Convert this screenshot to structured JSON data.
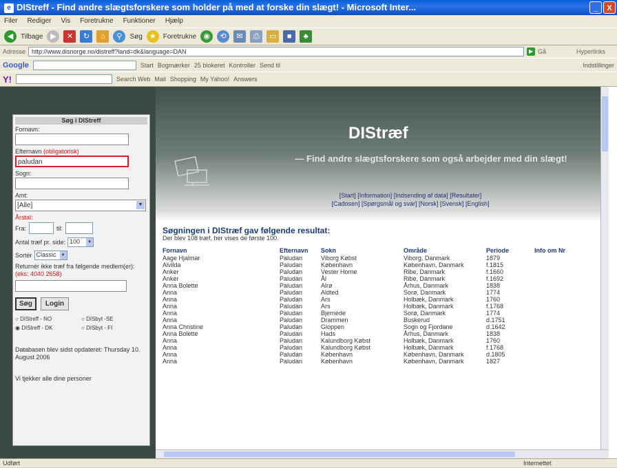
{
  "window": {
    "title": "DIStreff - Find andre slægtsforskere som holder på med at forske din slægt! - Microsoft Inter...",
    "minimize": "_",
    "close": "X"
  },
  "menubar": {
    "items": [
      "Filer",
      "Rediger",
      "Vis",
      "Foretrukne",
      "Funktioner",
      "Hjælp"
    ]
  },
  "toolbar": {
    "back": "Tilbage",
    "search": "Søg",
    "favorites": "Foretrukne"
  },
  "address": {
    "label": "Adresse",
    "url": "http://www.disnorge.no/distreff?land=dk&language=DAN",
    "go": "Gå",
    "links": "Hyperlinks"
  },
  "googlebar": {
    "label": "Google",
    "items": [
      "Start",
      "Bogmærker",
      "25 blokeret",
      "Kontroller",
      "Send til"
    ],
    "settings": "Indstillinger"
  },
  "yahoobar": {
    "logo": "Y!",
    "items": [
      "Search Web",
      "Mail",
      "Shopping",
      "My Yahoo!",
      "Answers"
    ]
  },
  "sidebar": {
    "header": "Søg i DIStreff",
    "fornavn_label": "Fornavn:",
    "fornavn_value": "",
    "efternavn_label": "Efternavn",
    "efternavn_required": "(obligatorisk)",
    "efternavn_value": "paludan",
    "sogn_label": "Sogn:",
    "sogn_value": "",
    "amt_label": "Amt:",
    "amt_value": "[Alle]",
    "arstal_label": "Årstal:",
    "fra_label": "Fra:",
    "til_label": "til:",
    "antal_label": "Antal træf pr. side:",
    "antal_value": "100",
    "sort_label": "Sortér",
    "sort_value": "Classic",
    "returner_label": "Returnér ikke træf fra følgende medlem(er):",
    "returner_example": "(eks: 4040 2658)",
    "sog_button": "Søg",
    "login_button": "Login",
    "radio_options": [
      "DIStreff - NO",
      "DISbyt -SE",
      "DIStreff - DK",
      "DISbyt - FI"
    ],
    "db_updated": "Databasen blev sidst opdateret: Thursday 10. August 2006",
    "checker": "Vi tjekker alle dine personer"
  },
  "banner": {
    "title": "DIStræf",
    "subtitle": "— Find andre slægtsforskere som også arbejder med din slægt!",
    "links_line1": "[Start] [Information] [Indsending af data] [Resultater]",
    "links_line2": "[Cadosen] [Spørgsmål og svar] [Norsk] [Svensk] [English]"
  },
  "results": {
    "title": "Søgningen i DIStræf gav følgende resultat:",
    "subtitle": "Der blev 108 træf, her vises de første 100.",
    "columns": [
      "Fornavn",
      "Efternavn",
      "Sokn",
      "Område",
      "Periode",
      "Info om Nr"
    ],
    "rows": [
      [
        "Aage Hjalmar",
        "Paludan",
        "Viborg Købst",
        "Viborg, Danmark",
        "1879",
        ""
      ],
      [
        "Alvilda",
        "Paludan",
        "København",
        "København, Danmark",
        "f.1815",
        ""
      ],
      [
        "Anker",
        "Paludan",
        "Vester Horne",
        "Ribe, Danmark",
        "f.1660",
        ""
      ],
      [
        "Anker",
        "Paludan",
        "Ål",
        "Ribe, Danmark",
        "f.1692",
        ""
      ],
      [
        "Anna Bolette",
        "Paludan",
        "Alrø",
        "Århus, Danmark",
        "1838",
        ""
      ],
      [
        "Anna",
        "Paludan",
        "Aldted",
        "Sorø, Danmark",
        "1774",
        ""
      ],
      [
        "Anna",
        "Paludan",
        "Ars",
        "Holbæk, Danmark",
        "1760",
        ""
      ],
      [
        "Anna",
        "Paludan",
        "Ars",
        "Holbæk, Danmark",
        "f.1768",
        ""
      ],
      [
        "Anna",
        "Paludan",
        "Bjernede",
        "Sorø, Danmark",
        "1774",
        ""
      ],
      [
        "Anna",
        "Paludan",
        "Drammen",
        "Buskerud",
        "d.1751",
        ""
      ],
      [
        "Anna Christine",
        "Paludan",
        "Gloppen",
        "Sogn og Fjordane",
        "d.1642",
        ""
      ],
      [
        "Anna Bolette",
        "Paludan",
        "Hads",
        "Århus, Danmark",
        "1838",
        ""
      ],
      [
        "Anna",
        "Paludan",
        "Kalundborg Købst",
        "Holbæk, Danmark",
        "1760",
        ""
      ],
      [
        "Anna",
        "Paludan",
        "Kalundborg Købst",
        "Holbæk, Danmark",
        "f.1768",
        ""
      ],
      [
        "Anna",
        "Paludan",
        "København",
        "København, Danmark",
        "d.1805",
        ""
      ],
      [
        "Anna",
        "Paludan",
        "København",
        "København, Danmark",
        "1827",
        ""
      ]
    ]
  },
  "statusbar": {
    "left": "Udført",
    "zone": "Internettet"
  }
}
